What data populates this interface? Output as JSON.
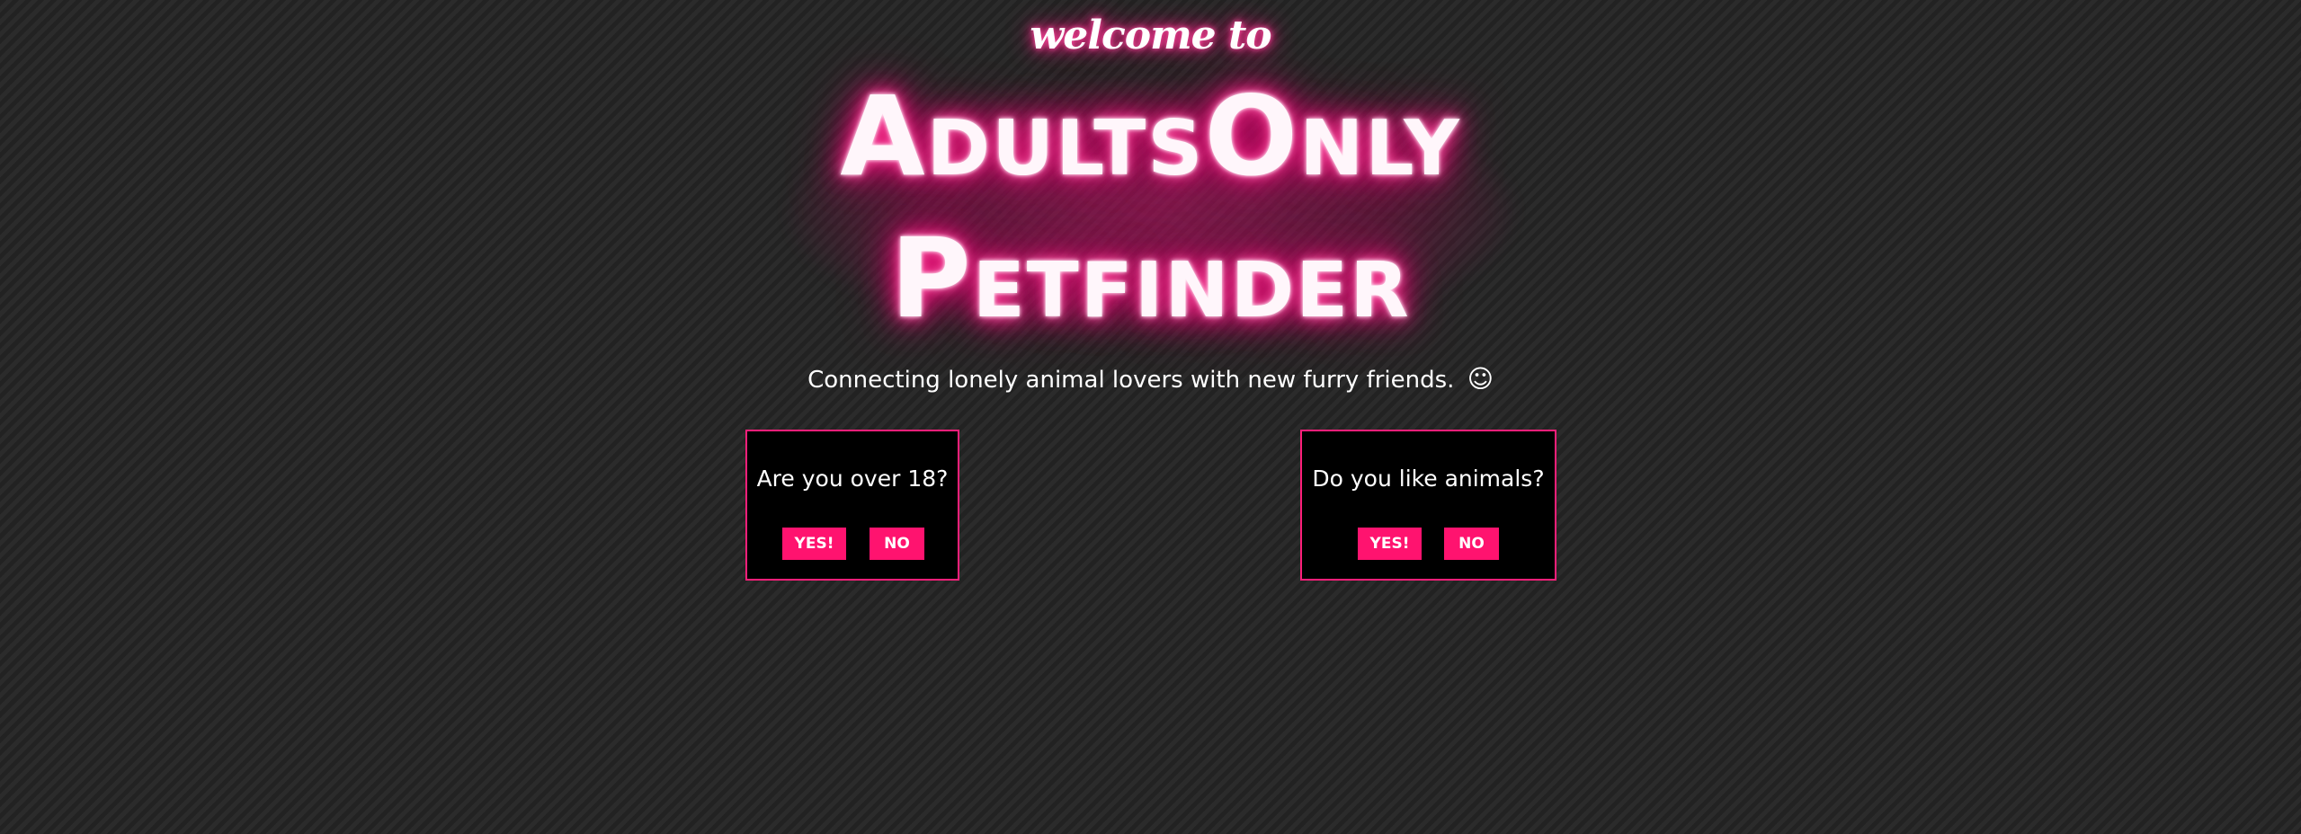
{
  "hero": {
    "welcome": "welcome to",
    "title_line1": "AdultsOnly",
    "title_line2": "Petfinder",
    "tagline": "Connecting lonely animal lovers with new furry friends.",
    "tagline_icon": "smiley-face-icon",
    "tagline_emoji": "☺"
  },
  "cards": [
    {
      "question": "Are you over 18?",
      "yes_label": "YES!",
      "no_label": "NO"
    },
    {
      "question": "Do you like animals?",
      "yes_label": "YES!",
      "no_label": "NO"
    }
  ],
  "colors": {
    "accent": "#ff136f",
    "neon_glow": "#ff2e8b",
    "background": "#262626",
    "card_background": "#000000"
  }
}
